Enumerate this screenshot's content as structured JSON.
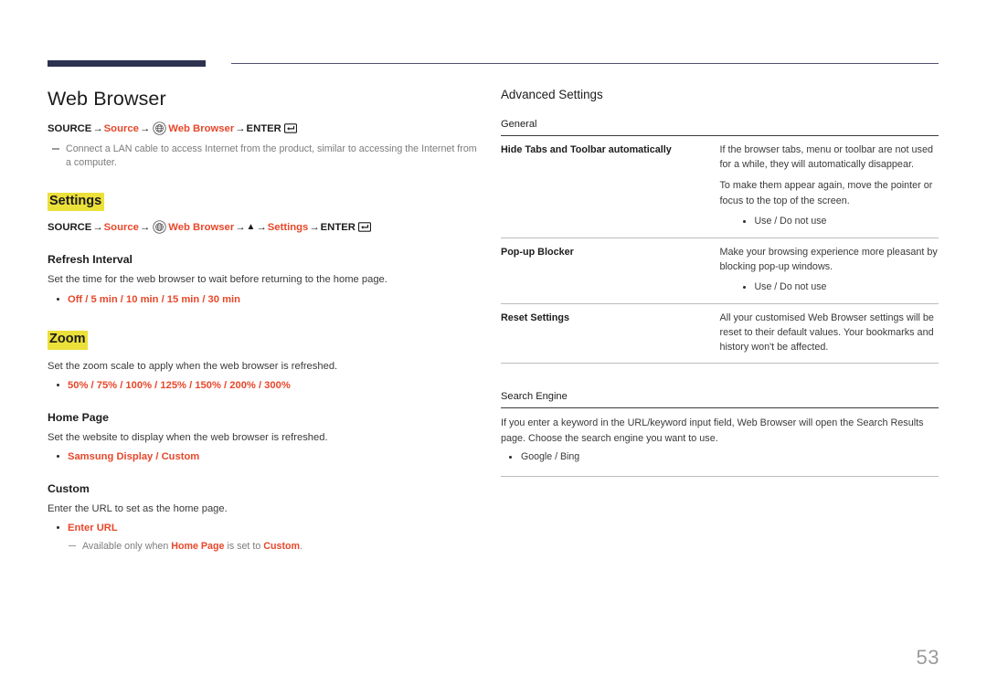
{
  "document": {
    "page_number": "53",
    "accent_red": "#e8472a",
    "highlight_yellow": "#ece03a",
    "header_bar_color": "#2c3250"
  },
  "left": {
    "title": "Web Browser",
    "path_main": {
      "source": "SOURCE",
      "arrow": "→",
      "source_red": "Source",
      "globe_icon": "globe-icon",
      "web_browser": "Web Browser",
      "enter": "ENTER",
      "enter_icon": "enter-key-icon"
    },
    "note_main": "Connect a LAN cable to access Internet from the product, similar to accessing the Internet from a computer.",
    "settings_heading": "Settings",
    "path_settings": {
      "source": "SOURCE",
      "source_red": "Source",
      "web_browser": "Web Browser",
      "up_arrow": "▲",
      "settings_red": "Settings",
      "enter": "ENTER"
    },
    "refresh": {
      "heading": "Refresh Interval",
      "body": "Set the time for the web browser to wait before returning to the home page.",
      "options": "Off / 5 min / 10 min / 15 min / 30 min"
    },
    "zoom": {
      "heading": "Zoom",
      "body": "Set the zoom scale to apply when the web browser is refreshed.",
      "options": "50% / 75% / 100% / 125% / 150% / 200% / 300%"
    },
    "home_page": {
      "heading": "Home Page",
      "body": "Set the website to display when the web browser is refreshed.",
      "options": "Samsung Display / Custom"
    },
    "custom": {
      "heading": "Custom",
      "body": "Enter the URL to set as the home page.",
      "options": "Enter URL",
      "note_prefix": "Available only when ",
      "note_link1": "Home Page",
      "note_middle": " is set to ",
      "note_link2": "Custom",
      "note_suffix": "."
    }
  },
  "right": {
    "advanced_title": "Advanced Settings",
    "general_label": "General",
    "rows": [
      {
        "name": "Hide Tabs and Toolbar automatically",
        "paragraphs": [
          "If the browser tabs, menu or toolbar are not used for a while, they will automatically disappear.",
          "To make them appear again, move the pointer or focus to the top of the screen."
        ],
        "bullets": [
          "Use / Do not use"
        ]
      },
      {
        "name": "Pop-up Blocker",
        "paragraphs": [
          "Make your browsing experience more pleasant by blocking pop-up windows."
        ],
        "bullets": [
          "Use / Do not use"
        ]
      },
      {
        "name": "Reset Settings",
        "paragraphs": [
          "All your customised Web Browser settings will be reset to their default values. Your bookmarks and history won't be affected."
        ],
        "bullets": []
      }
    ],
    "search_engine": {
      "label": "Search Engine",
      "body": "If you enter a keyword in the URL/keyword input field, Web Browser will open the Search Results page. Choose the search engine you want to use.",
      "bullets": [
        "Google / Bing"
      ]
    }
  }
}
